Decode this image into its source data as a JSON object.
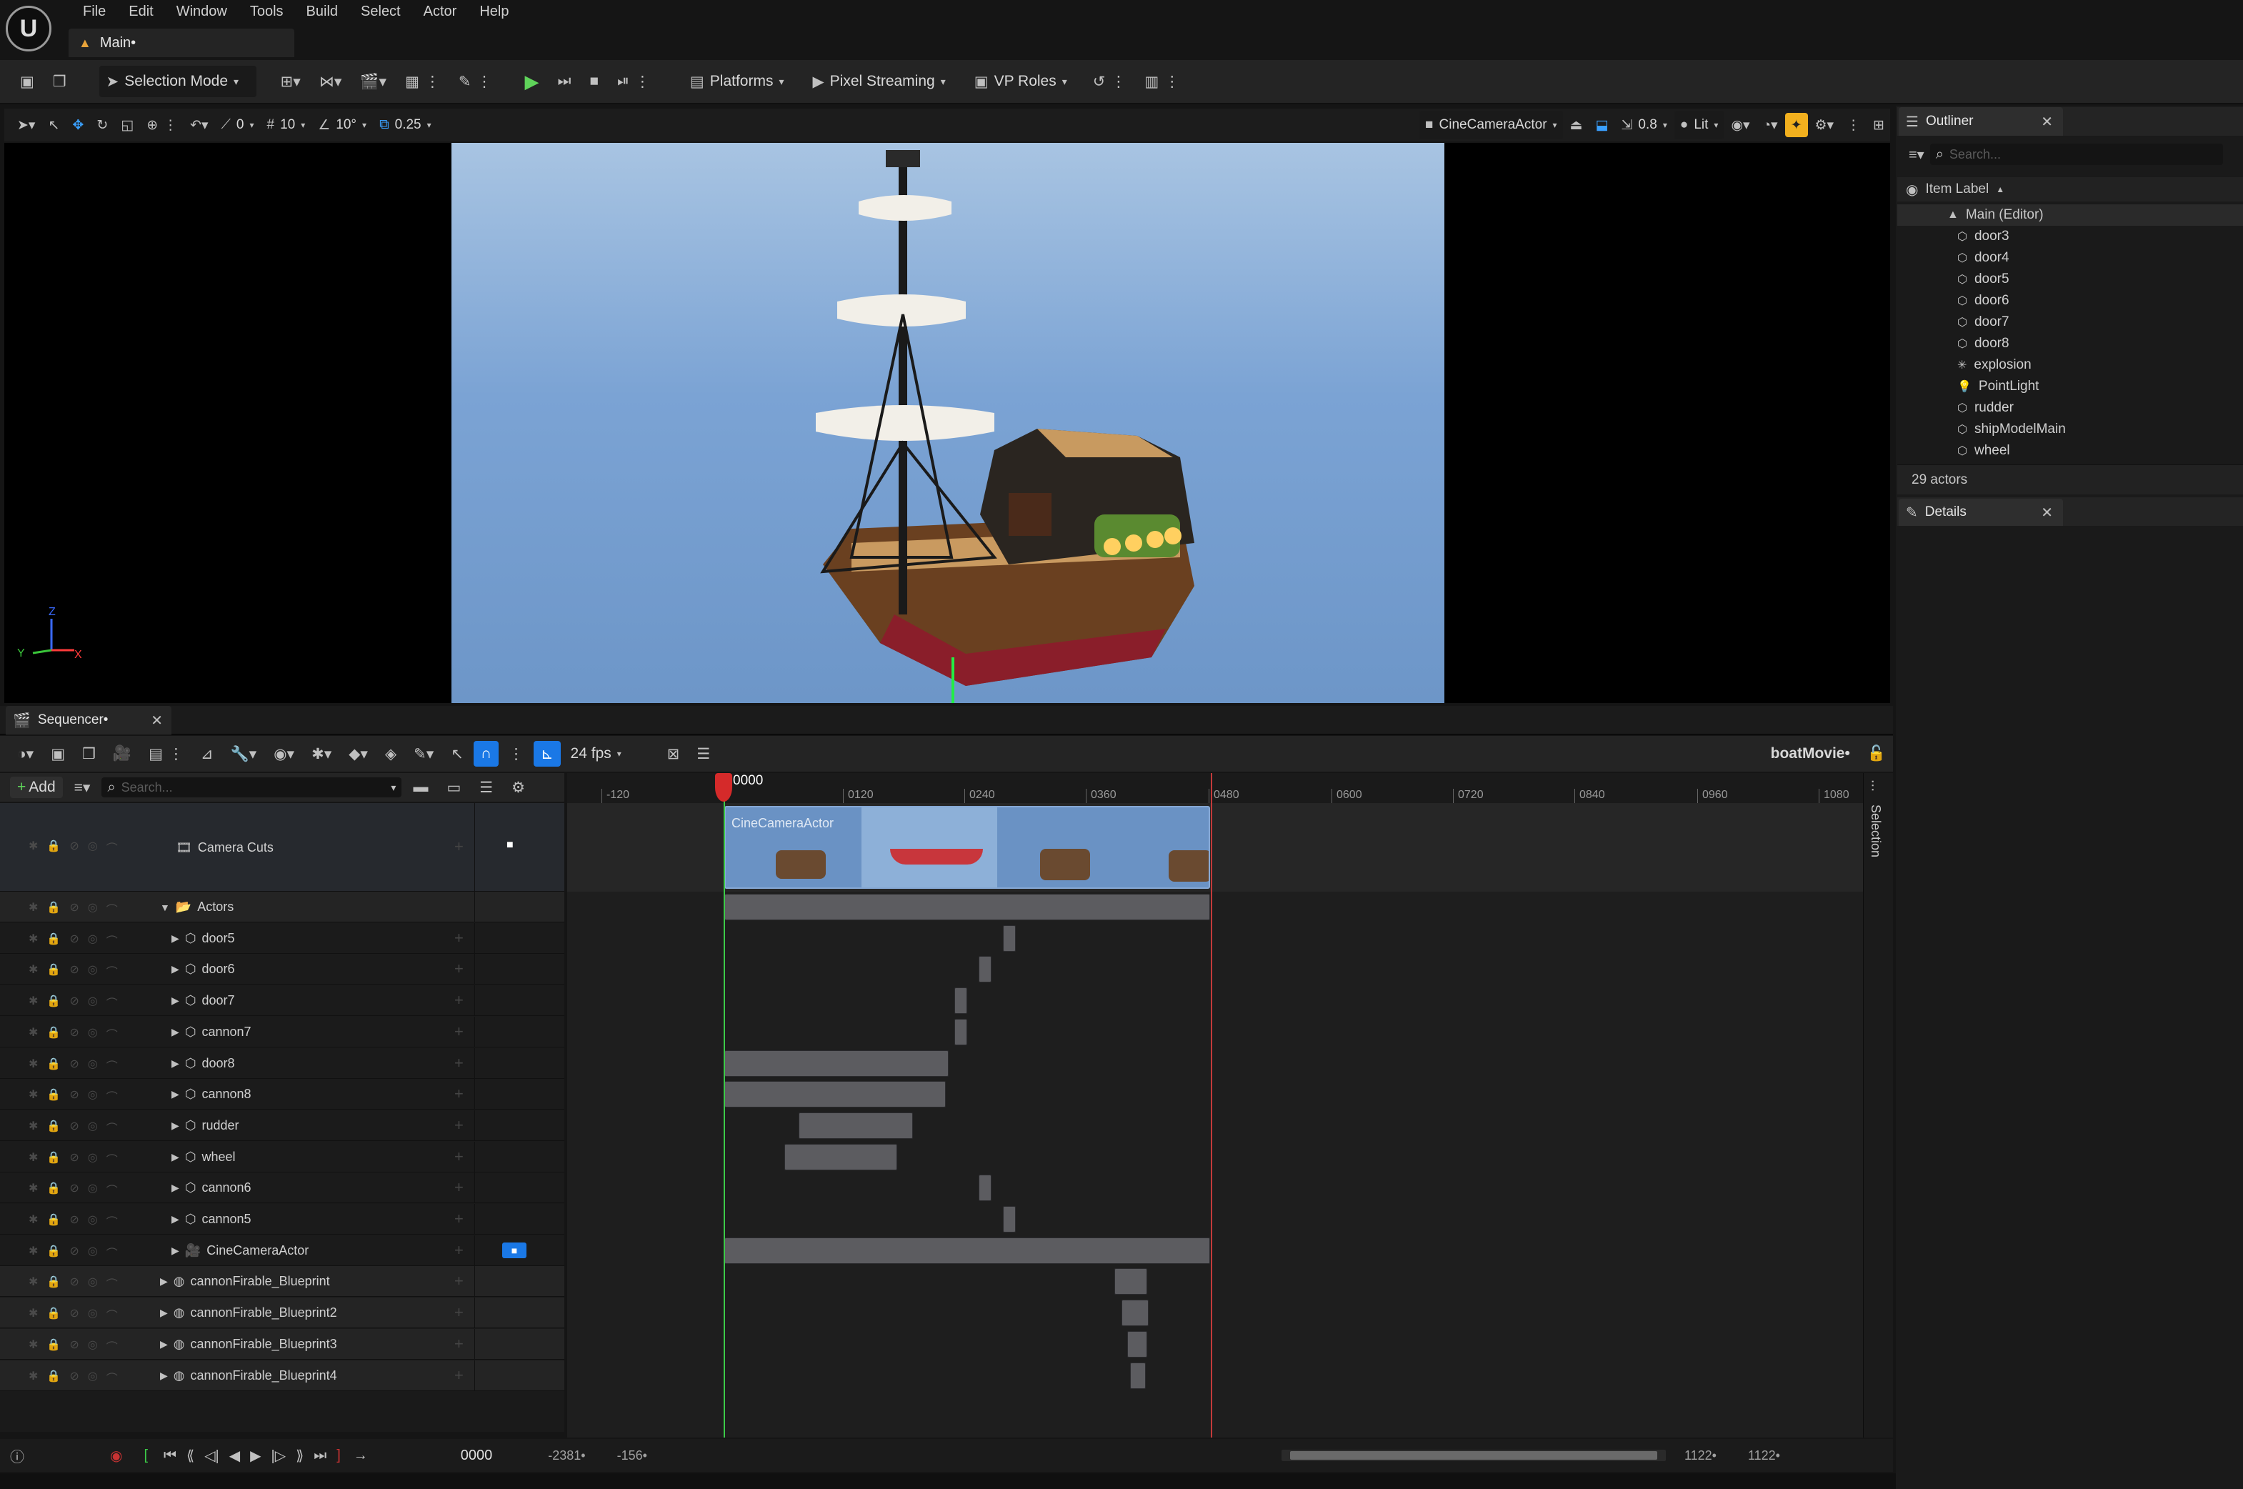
{
  "menu": [
    "File",
    "Edit",
    "Window",
    "Tools",
    "Build",
    "Select",
    "Actor",
    "Help"
  ],
  "doc_tab": "Main•",
  "toolbar": {
    "selection_mode": "Selection Mode",
    "platforms": "Platforms",
    "pixel_streaming": "Pixel Streaming",
    "vp_roles": "VP Roles"
  },
  "viewport_toolbar": {
    "rot_snap": "0",
    "grid": "10",
    "angle": "10°",
    "scale": "0.25",
    "camera": "CineCameraActor",
    "speed": "0.8",
    "view_mode": "Lit"
  },
  "axis": {
    "z": "Z",
    "y": "Y",
    "x": "X"
  },
  "sequencer": {
    "tab": "Sequencer•",
    "fps": "24 fps",
    "sequence_name": "boatMovie•",
    "add_label": "Add",
    "search_placeholder": "Search...",
    "selection_label": "Selection",
    "playhead": "0000",
    "current_frame": "0000",
    "range_start": "-2381•",
    "range_in": "-156•",
    "range_out": "1122•",
    "range_end": "1122•",
    "ruler_ticks": [
      "-120",
      "0120",
      "0240",
      "0360",
      "0480",
      "0600",
      "0720",
      "0840",
      "0960",
      "1080"
    ],
    "camera_cuts_label": "Camera Cuts",
    "camera_cuts_clip": "CineCameraActor",
    "tracks": [
      {
        "label": "Actors",
        "type": "folder"
      },
      {
        "label": "door5",
        "type": "mesh"
      },
      {
        "label": "door6",
        "type": "mesh"
      },
      {
        "label": "door7",
        "type": "mesh"
      },
      {
        "label": "cannon7",
        "type": "mesh"
      },
      {
        "label": "door8",
        "type": "mesh"
      },
      {
        "label": "cannon8",
        "type": "mesh"
      },
      {
        "label": "rudder",
        "type": "mesh"
      },
      {
        "label": "wheel",
        "type": "mesh"
      },
      {
        "label": "cannon6",
        "type": "mesh"
      },
      {
        "label": "cannon5",
        "type": "mesh"
      },
      {
        "label": "CineCameraActor",
        "type": "camera"
      },
      {
        "label": "cannonFirable_Blueprint",
        "type": "bp"
      },
      {
        "label": "cannonFirable_Blueprint2",
        "type": "bp"
      },
      {
        "label": "cannonFirable_Blueprint3",
        "type": "bp"
      },
      {
        "label": "cannonFirable_Blueprint4",
        "type": "bp"
      }
    ]
  },
  "outliner": {
    "tab": "Outliner",
    "search_placeholder": "Search...",
    "column": "Item Label",
    "root": "Main (Editor)",
    "items": [
      "door3",
      "door4",
      "door5",
      "door6",
      "door7",
      "door8",
      "explosion",
      "PointLight",
      "rudder",
      "shipModelMain",
      "wheel"
    ],
    "count": "29 actors"
  },
  "details": {
    "tab": "Details"
  }
}
